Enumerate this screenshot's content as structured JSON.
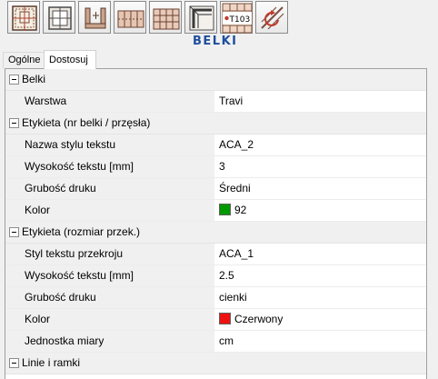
{
  "toolbar": {
    "buttons": [
      {
        "icon": "beam-grid-icon"
      },
      {
        "icon": "beam-frame-icon"
      },
      {
        "icon": "beam-dimension-icon"
      },
      {
        "icon": "beam-columns-icon"
      },
      {
        "icon": "beam-layers-icon"
      },
      {
        "icon": "beam-corner-icon"
      },
      {
        "icon": "beam-label-icon",
        "label": "T103"
      },
      {
        "icon": "beam-rotate-icon"
      }
    ],
    "title": "BELKI",
    "title_color": "#1e4f9c"
  },
  "tabs": [
    {
      "label": "Ogólne",
      "active": false
    },
    {
      "label": "Dostosuj",
      "active": true
    }
  ],
  "grid": {
    "sections": [
      {
        "label": "Belki",
        "props": [
          {
            "name": "Warstwa",
            "value": "Travi"
          }
        ]
      },
      {
        "label": "Etykieta (nr belki / przęsła)",
        "props": [
          {
            "name": "Nazwa stylu tekstu",
            "value": "ACA_2"
          },
          {
            "name": "Wysokość tekstu [mm]",
            "value": "3"
          },
          {
            "name": "Grubość druku",
            "value": "Średni"
          },
          {
            "name": "Kolor",
            "value": "92",
            "swatch": "#009900"
          }
        ]
      },
      {
        "label": "Etykieta (rozmiar przek.)",
        "props": [
          {
            "name": "Styl tekstu przekroju",
            "value": "ACA_1"
          },
          {
            "name": "Wysokość tekstu [mm]",
            "value": "2.5"
          },
          {
            "name": "Grubość druku",
            "value": "cienki"
          },
          {
            "name": "Kolor",
            "value": "Czerwony",
            "swatch": "#ee1111"
          },
          {
            "name": "Jednostka miary",
            "value": "cm"
          }
        ]
      },
      {
        "label": "Linie i ramki",
        "props": []
      }
    ]
  }
}
